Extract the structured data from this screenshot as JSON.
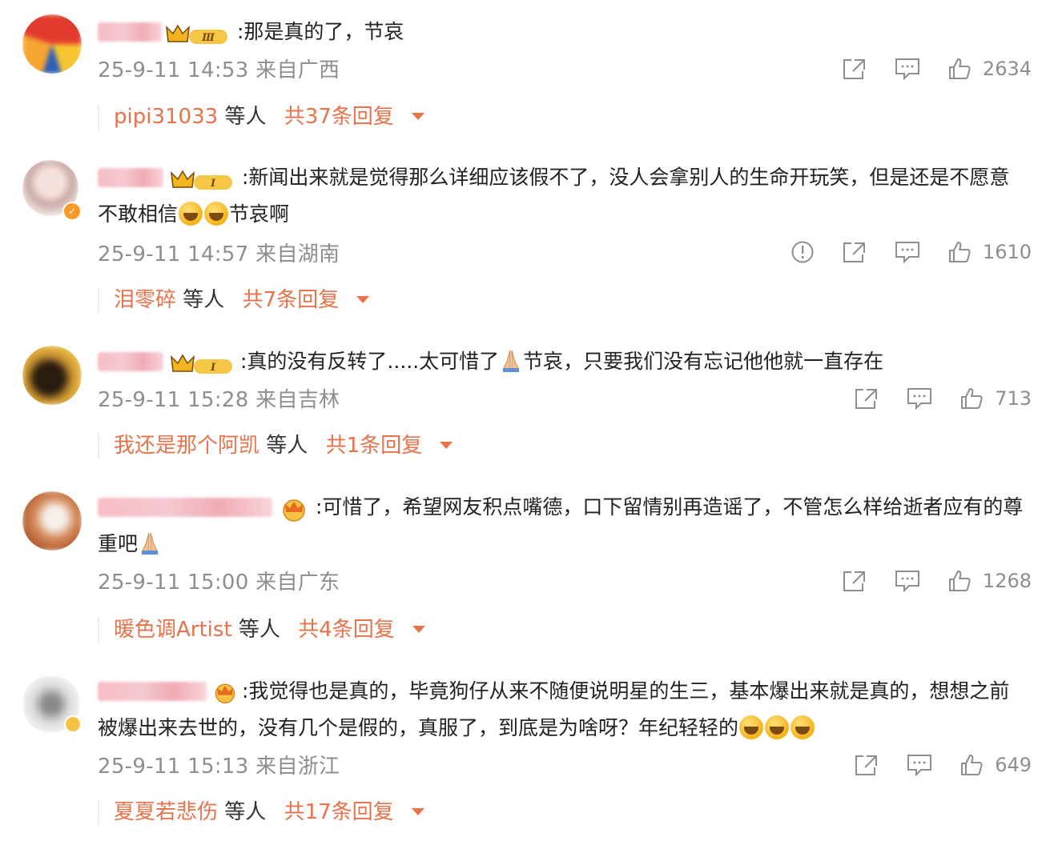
{
  "comments": [
    {
      "text_pre": ":那是真的了，节哀",
      "text_post": "",
      "time": "25-9-11 14:53",
      "location": "来自广西",
      "likes": "2634",
      "reply_user": "pipi31033",
      "reply_mid": "等人",
      "reply_total": "共37条回复",
      "level_badge": "Ⅲ",
      "has_report": false
    },
    {
      "text_pre": ":新闻出来就是觉得那么详细应该假不了，没人会拿别人的生命开玩笑，但是还是不愿意 不敢相信",
      "text_post": "节哀啊",
      "time": "25-9-11 14:57",
      "location": "来自湖南",
      "likes": "1610",
      "reply_user": "泪零碎",
      "reply_mid": "等人",
      "reply_total": "共7条回复",
      "level_badge": "I",
      "has_report": true
    },
    {
      "text_pre": ":真的没有反转了.....太可惜了",
      "text_post": "节哀，只要我们没有忘记他他就一直存在",
      "time": "25-9-11 15:28",
      "location": "来自吉林",
      "likes": "713",
      "reply_user": "我还是那个阿凯",
      "reply_mid": "等人",
      "reply_total": "共1条回复",
      "level_badge": "I",
      "has_report": false
    },
    {
      "text_pre": ":可惜了，希望网友积点嘴德，口下留情别再造谣了，不管怎么样给逝者应有的尊重吧",
      "text_post": "",
      "time": "25-9-11 15:00",
      "location": "来自广东",
      "likes": "1268",
      "reply_user": "暖色调Artist",
      "reply_mid": "等人",
      "reply_total": "共4条回复",
      "level_badge": "",
      "has_report": false
    },
    {
      "text_pre": ":我觉得也是真的，毕竟狗仔从来不随便说明星的生三，基本爆出来就是真的，想想之前被爆出来去世的，没有几个是假的，真服了，到底是为啥呀？年纪轻轻的",
      "text_post": "",
      "time": "25-9-11 15:13",
      "location": "来自浙江",
      "likes": "649",
      "reply_user": "夏夏若悲伤",
      "reply_mid": "等人",
      "reply_total": "共17条回复",
      "level_badge": "",
      "has_report": false
    }
  ],
  "icons": {
    "share": "share-icon",
    "comment": "comment-icon",
    "like": "like-icon",
    "report": "report-icon"
  },
  "colors": {
    "accent": "#e8724a",
    "meta": "#8e8e8e",
    "text": "#222222"
  }
}
